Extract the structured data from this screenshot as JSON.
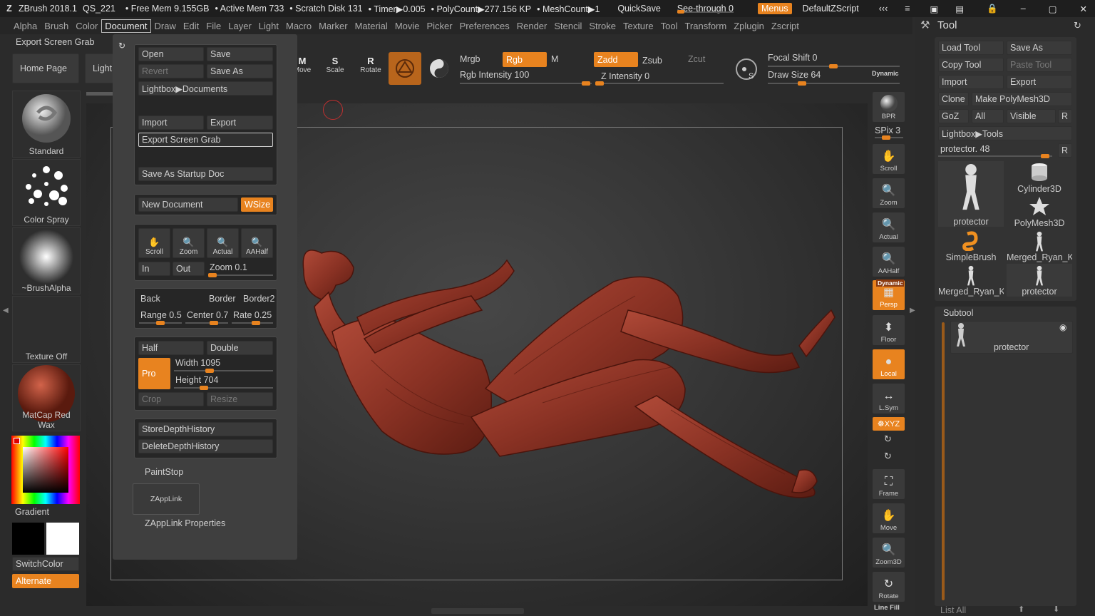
{
  "title": {
    "app": "ZBrush 2018.1",
    "doc": "QS_221",
    "freemem": "• Free Mem 9.155GB",
    "activemem": "• Active Mem 733",
    "scratch": "• Scratch Disk 131",
    "timer": "• Timer▶0.005",
    "polycount": "• PolyCount▶277.156 KP",
    "meshcount": "• MeshCount▶1",
    "quicksave": "QuickSave",
    "seethrough": "See-through  0",
    "menus": "Menus",
    "script": "DefaultZScript"
  },
  "menubar": [
    "Alpha",
    "Brush",
    "Color",
    "Document",
    "Draw",
    "Edit",
    "File",
    "Layer",
    "Light",
    "Macro",
    "Marker",
    "Material",
    "Movie",
    "Picker",
    "Preferences",
    "Render",
    "Stencil",
    "Stroke",
    "Texture",
    "Tool",
    "Transform",
    "Zplugin",
    "Zscript"
  ],
  "left": {
    "export_grab": "Export Screen Grab",
    "home": "Home Page",
    "lightbox": "LightBox",
    "brush": "Standard",
    "stroke": "Color Spray",
    "alpha": "~BrushAlpha",
    "texture": "Texture Off",
    "material": "MatCap Red Wax",
    "gradient": "Gradient",
    "switchcolor": "SwitchColor",
    "alternate": "Alternate"
  },
  "top": {
    "move": "Move",
    "scale": "Scale",
    "rotate": "Rotate",
    "mrgb": "Mrgb",
    "rgb": "Rgb",
    "m": "M",
    "zadd": "Zadd",
    "zsub": "Zsub",
    "zcut": "Zcut",
    "rgb_intensity": "Rgb Intensity 100",
    "z_intensity": "Z Intensity 0",
    "focal_shift": "Focal Shift 0",
    "draw_size": "Draw Size 64",
    "dynamic": "Dynamic"
  },
  "document_menu": {
    "open": "Open",
    "save": "Save",
    "revert": "Revert",
    "save_as": "Save As",
    "lightbox_docs": "Lightbox▶Documents",
    "import": "Import",
    "export": "Export",
    "export_grab": "Export Screen Grab",
    "save_startup": "Save As Startup Doc",
    "new_doc": "New Document",
    "wsize": "WSize",
    "scroll": "Scroll",
    "zoom": "Zoom",
    "actual": "Actual",
    "aahalf": "AAHalf",
    "in": "In",
    "out": "Out",
    "zoom_val": "Zoom 0.1",
    "back": "Back",
    "border": "Border",
    "border2": "Border2",
    "range": "Range 0.5",
    "center": "Center 0.7",
    "rate": "Rate 0.25",
    "half": "Half",
    "double": "Double",
    "pro": "Pro",
    "width": "Width 1095",
    "height": "Height 704",
    "crop": "Crop",
    "resize": "Resize",
    "store_depth": "StoreDepthHistory",
    "delete_depth": "DeleteDepthHistory",
    "paintstop": "PaintStop",
    "zapplink": "ZAppLink",
    "zapplink_props": "ZAppLink Properties"
  },
  "rightshelf": {
    "bpr": "BPR",
    "spix": "SPix 3",
    "scroll": "Scroll",
    "zoom": "Zoom",
    "actual": "Actual",
    "aahalf": "AAHalf",
    "dynamic": "Dynamic",
    "persp": "Persp",
    "floor": "Floor",
    "local": "Local",
    "lsym": "L.Sym",
    "xyz": "☸XYZ",
    "frame": "Frame",
    "move": "Move",
    "zoom3d": "Zoom3D",
    "rotate": "Rotate",
    "linefill": "Line Fill"
  },
  "tool": {
    "header": "Tool",
    "load": "Load Tool",
    "save_as": "Save As",
    "copy": "Copy Tool",
    "paste": "Paste Tool",
    "import": "Import",
    "export": "Export",
    "clone": "Clone",
    "make_poly": "Make PolyMesh3D",
    "goz": "GoZ",
    "all": "All",
    "visible": "Visible",
    "r": "R",
    "lightbox_tools": "Lightbox▶Tools",
    "protector_slider": "protector. 48",
    "items": [
      "protector",
      "Cylinder3D",
      "PolyMesh3D",
      "SimpleBrush",
      "Merged_Ryan_Ki",
      "Merged_Ryan_Ki",
      "protector"
    ],
    "subtool": "Subtool",
    "subtool_item": "protector",
    "list_all": "List All"
  }
}
